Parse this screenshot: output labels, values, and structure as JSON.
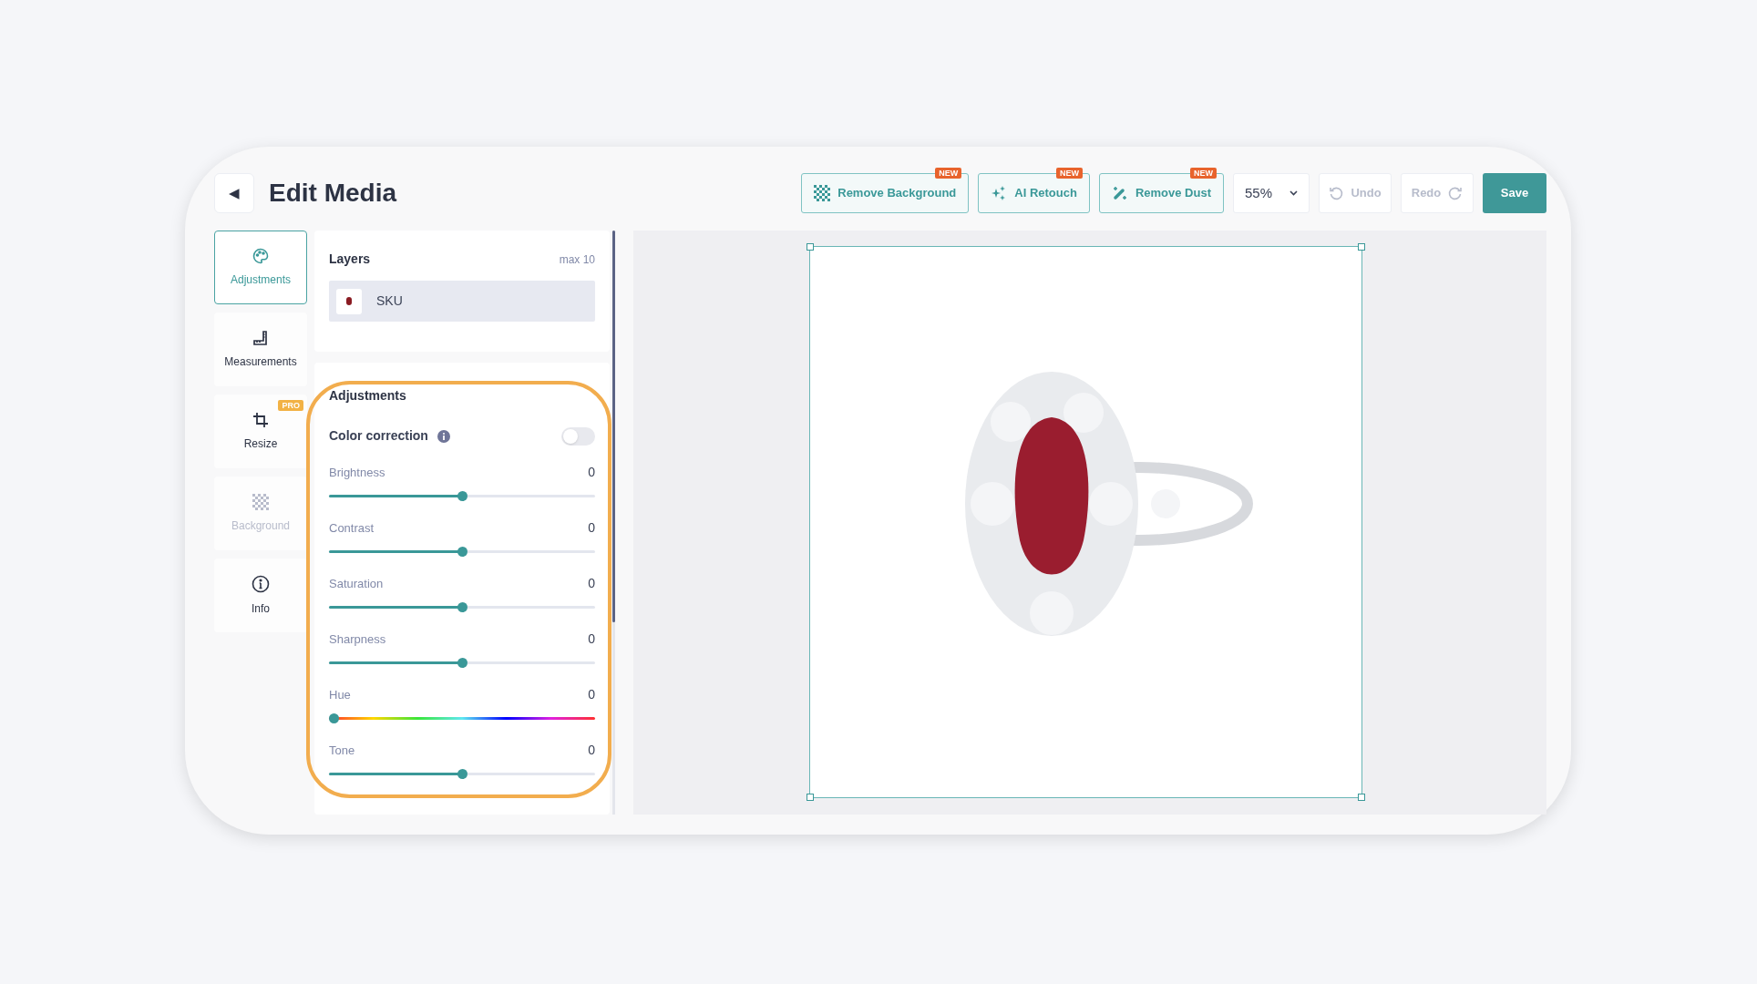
{
  "header": {
    "back": "◀",
    "title": "Edit Media"
  },
  "toolbar": {
    "tools": [
      {
        "kind": "background",
        "label": "Remove Background",
        "badge": "NEW"
      },
      {
        "kind": "retouch",
        "label": "AI Retouch",
        "badge": "NEW"
      },
      {
        "kind": "dust",
        "label": "Remove Dust",
        "badge": "NEW"
      }
    ],
    "zoom": "55%",
    "undo": {
      "label": "Undo",
      "disabled": true
    },
    "redo": {
      "label": "Redo",
      "disabled": true
    },
    "save": "Save"
  },
  "sidebar": {
    "items": [
      {
        "kind": "palette",
        "label": "Adjustments",
        "selected": true,
        "disabled": false
      },
      {
        "kind": "ruler",
        "label": "Measurements",
        "selected": false,
        "disabled": false
      },
      {
        "kind": "crop",
        "label": "Resize",
        "selected": false,
        "disabled": false,
        "badge": "PRO"
      },
      {
        "kind": "checker",
        "label": "Background",
        "selected": false,
        "disabled": true
      },
      {
        "kind": "info",
        "label": "Info",
        "selected": false,
        "disabled": false
      }
    ]
  },
  "layers": {
    "title": "Layers",
    "limit": "max 10",
    "items": [
      {
        "name": "SKU",
        "selected": true
      }
    ]
  },
  "adjustments": {
    "title": "Adjustments",
    "color_correction": {
      "label": "Color correction",
      "on": false
    },
    "sliders": [
      {
        "kind": "standard",
        "label": "Brightness",
        "value": "0",
        "level": 0.5
      },
      {
        "kind": "standard",
        "label": "Contrast",
        "value": "0",
        "level": 0.5
      },
      {
        "kind": "standard",
        "label": "Saturation",
        "value": "0",
        "level": 0.5
      },
      {
        "kind": "standard",
        "label": "Sharpness",
        "value": "0",
        "level": 0.5
      },
      {
        "kind": "hue",
        "label": "Hue",
        "value": "0",
        "level": 0
      },
      {
        "kind": "standard",
        "label": "Tone",
        "value": "0",
        "level": 0.5
      }
    ]
  }
}
